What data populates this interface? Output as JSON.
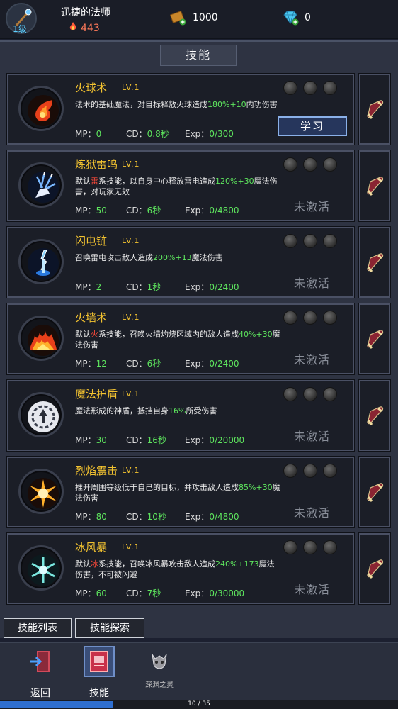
{
  "player": {
    "name": "迅捷的法师",
    "level": "1级",
    "power": "443"
  },
  "resources": {
    "gold": "1000",
    "gems": "0"
  },
  "panel": {
    "title": "技能"
  },
  "skills": [
    {
      "name": "火球术",
      "level": "LV.1",
      "desc": [
        {
          "t": "法术的基础魔法，对目标释放火球造成"
        },
        {
          "t": "180%+10",
          "c": "g"
        },
        {
          "t": "内功伤害"
        }
      ],
      "mp": "0",
      "cd": "0.8秒",
      "exp": "0/300",
      "action": "学习",
      "icon": "fireball-icon"
    },
    {
      "name": "炼狱雷鸣",
      "level": "LV.1",
      "desc": [
        {
          "t": "默认"
        },
        {
          "t": "雷",
          "c": "r"
        },
        {
          "t": "系技能，以自身中心释放雷电造成"
        },
        {
          "t": "120%+30",
          "c": "g"
        },
        {
          "t": "魔法伤害，对玩家无效"
        }
      ],
      "mp": "50",
      "cd": "6秒",
      "exp": "0/4800",
      "action": "未激活",
      "icon": "thunder-hand-icon"
    },
    {
      "name": "闪电链",
      "level": "LV.1",
      "desc": [
        {
          "t": "召唤雷电攻击敌人造成"
        },
        {
          "t": "200%+13",
          "c": "g"
        },
        {
          "t": "魔法伤害"
        }
      ],
      "mp": "2",
      "cd": "1秒",
      "exp": "0/2400",
      "action": "未激活",
      "icon": "lightning-chain-icon"
    },
    {
      "name": "火墙术",
      "level": "LV.1",
      "desc": [
        {
          "t": "默认"
        },
        {
          "t": "火",
          "c": "r"
        },
        {
          "t": "系技能，召唤火墙灼烧区域内的敌人造成"
        },
        {
          "t": "40%+30",
          "c": "g"
        },
        {
          "t": "魔法伤害"
        }
      ],
      "mp": "12",
      "cd": "6秒",
      "exp": "0/2400",
      "action": "未激活",
      "icon": "fire-wall-icon"
    },
    {
      "name": "魔法护盾",
      "level": "LV.1",
      "desc": [
        {
          "t": "魔法形成的神盾，抵挡自身"
        },
        {
          "t": "16%",
          "c": "g"
        },
        {
          "t": "所受伤害"
        }
      ],
      "mp": "30",
      "cd": "16秒",
      "exp": "0/20000",
      "action": "未激活",
      "icon": "magic-shield-icon"
    },
    {
      "name": "烈焰震击",
      "level": "LV.1",
      "desc": [
        {
          "t": "推开周围等级低于自己的目标，并攻击敌人造成"
        },
        {
          "t": "85%+30",
          "c": "g"
        },
        {
          "t": "魔法伤害"
        }
      ],
      "mp": "80",
      "cd": "10秒",
      "exp": "0/4800",
      "action": "未激活",
      "icon": "flame-burst-icon"
    },
    {
      "name": "冰风暴",
      "level": "LV.1",
      "desc": [
        {
          "t": "默认"
        },
        {
          "t": "冰",
          "c": "r"
        },
        {
          "t": "系技能，召唤冰风暴攻击敌人造成"
        },
        {
          "t": "240%+173",
          "c": "g"
        },
        {
          "t": "魔法伤害，不可被闪避"
        }
      ],
      "mp": "60",
      "cd": "7秒",
      "exp": "0/30000",
      "action": "未激活",
      "icon": "ice-storm-icon"
    }
  ],
  "labels": {
    "mp": "MP：",
    "cd": "CD：",
    "exp": "Exp："
  },
  "subtabs": [
    "技能列表",
    "技能探索"
  ],
  "nav": {
    "back": "返回",
    "skill": "技能",
    "abyss": "深渊之灵"
  },
  "progress": {
    "text": "10 / 35",
    "fraction": 0.2857
  },
  "colors": {
    "name": "#f2c230",
    "highlight": "#5ee65e",
    "element": "#ff4a3a",
    "inactive": "#8a8f9a",
    "progress": "#2f6fd0"
  }
}
